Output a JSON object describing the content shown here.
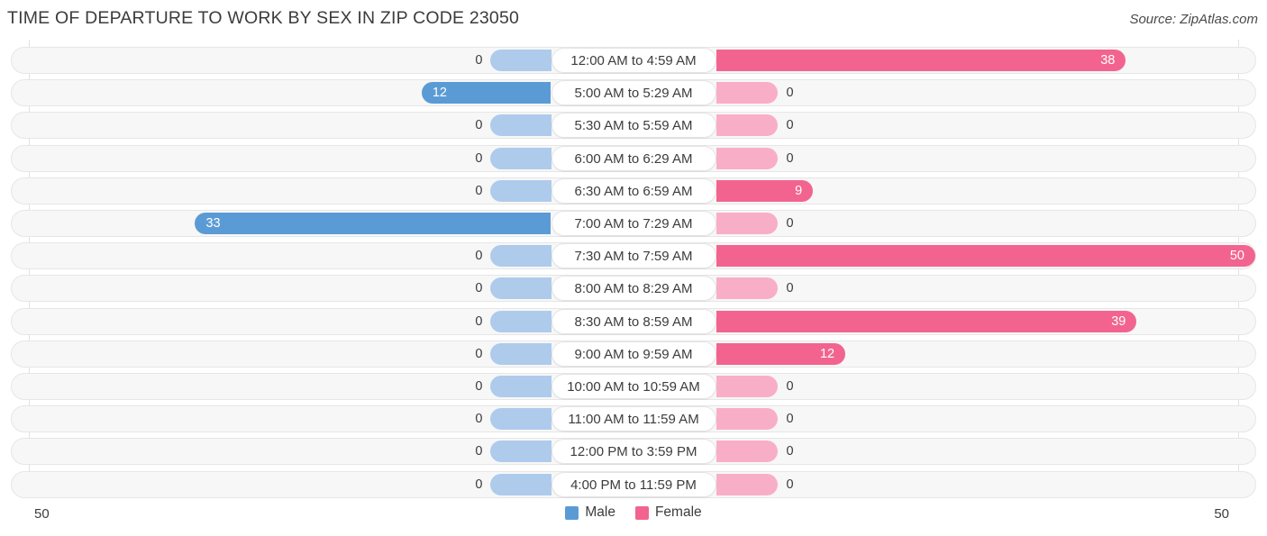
{
  "header": {
    "title": "TIME OF DEPARTURE TO WORK BY SEX IN ZIP CODE 23050",
    "source": "Source: ZipAtlas.com"
  },
  "legend": {
    "male_label": "Male",
    "female_label": "Female",
    "male_color": "#5b9bd5",
    "female_color": "#f2648f"
  },
  "axis": {
    "left_label": "50",
    "right_label": "50"
  },
  "colors": {
    "male_strong": "#5b9bd5",
    "male_light": "#aecbec",
    "female_strong": "#f2648f",
    "female_light": "#f9aec8",
    "track_bg": "#f7f7f7",
    "track_border": "#e6e6e6"
  },
  "chart_data": {
    "type": "bar",
    "subtype": "diverging-bar",
    "title": "TIME OF DEPARTURE TO WORK BY SEX IN ZIP CODE 23050",
    "xlabel": "",
    "ylabel": "",
    "xlim": [
      50,
      50
    ],
    "axis_max": 50,
    "grid": false,
    "legend_position": "bottom-center",
    "categories": [
      "12:00 AM to 4:59 AM",
      "5:00 AM to 5:29 AM",
      "5:30 AM to 5:59 AM",
      "6:00 AM to 6:29 AM",
      "6:30 AM to 6:59 AM",
      "7:00 AM to 7:29 AM",
      "7:30 AM to 7:59 AM",
      "8:00 AM to 8:29 AM",
      "8:30 AM to 8:59 AM",
      "9:00 AM to 9:59 AM",
      "10:00 AM to 10:59 AM",
      "11:00 AM to 11:59 AM",
      "12:00 PM to 3:59 PM",
      "4:00 PM to 11:59 PM"
    ],
    "series": [
      {
        "name": "Male",
        "direction": "left",
        "color": "#5b9bd5",
        "values": [
          0,
          12,
          0,
          0,
          0,
          33,
          0,
          0,
          0,
          0,
          0,
          0,
          0,
          0
        ]
      },
      {
        "name": "Female",
        "direction": "right",
        "color": "#f2648f",
        "values": [
          38,
          0,
          0,
          0,
          9,
          0,
          50,
          0,
          39,
          12,
          0,
          0,
          0,
          0
        ]
      }
    ]
  }
}
